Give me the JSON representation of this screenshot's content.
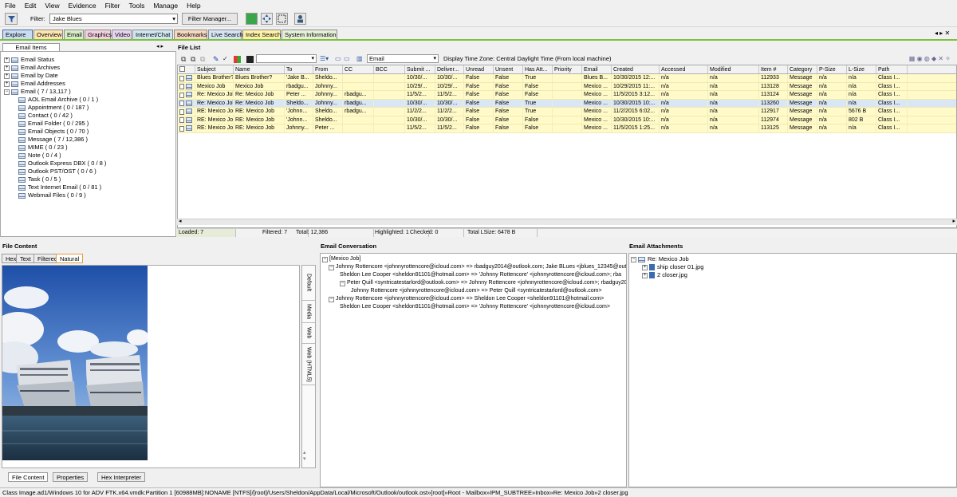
{
  "menu": [
    "File",
    "Edit",
    "View",
    "Evidence",
    "Filter",
    "Tools",
    "Manage",
    "Help"
  ],
  "toolbar": {
    "filter_label": "Filter:",
    "filter_value": "Jake Blues",
    "filter_manager": "Filter Manager..."
  },
  "tabs": [
    "Explore",
    "Overview",
    "Email",
    "Graphics",
    "Video",
    "Internet/Chat",
    "Bookmarks",
    "Live Search",
    "Index Search",
    "System Information"
  ],
  "email_items": {
    "tab": "Email Items",
    "tree": [
      "Email Status",
      "Email Archives",
      "Email by Date",
      "Email Addresses",
      "Email ( 7 / 13,117 )",
      "AOL Email Archive ( 0 / 1 )",
      "Appointment ( 0 / 187 )",
      "Contact ( 0 / 42 )",
      "Email Folder ( 0 / 295 )",
      "Email Objects ( 0 / 70 )",
      "Message ( 7 / 12,386 )",
      "MIME ( 0 / 23 )",
      "Note ( 0 / 4 )",
      "Outlook Express DBX ( 0 / 8 )",
      "Outlook PST/OST ( 0 / 6 )",
      "Task ( 0 / 5 )",
      "Text Internet Email ( 0 / 81 )",
      "Webmail Files ( 0 / 9 )"
    ]
  },
  "file_list": {
    "title": "File List",
    "view_select": "Email",
    "timezone": "Display Time Zone: Central Daylight Time  (From local machine)",
    "columns": [
      "Subject",
      "Name",
      "To",
      "From",
      "CC",
      "BCC",
      "Submit ...",
      "Deliver...",
      "Unread",
      "Unsent",
      "Has Att...",
      "Priority",
      "Email",
      "Created",
      "Accessed",
      "Modified",
      "Item #",
      "Category",
      "P-Size",
      "L-Size",
      "Path"
    ],
    "rows": [
      [
        "Blues Brother?",
        "Blues Brother?",
        "'Jake B...",
        "Sheldo...",
        "",
        "",
        "10/30/...",
        "10/30/...",
        "False",
        "False",
        "True",
        "",
        "Blues B...",
        "10/30/2015 12:...",
        "n/a",
        "n/a",
        "112933",
        "Message",
        "n/a",
        "n/a",
        "Class I..."
      ],
      [
        "Mexico Job",
        "Mexico Job",
        "rbadgu...",
        "Johnny...",
        "",
        "",
        "10/29/...",
        "10/29/...",
        "False",
        "False",
        "False",
        "",
        "Mexico ...",
        "10/29/2015 11:...",
        "n/a",
        "n/a",
        "113128",
        "Message",
        "n/a",
        "n/a",
        "Class I..."
      ],
      [
        "Re: Mexico Job",
        "Re: Mexico Job",
        "Peter ...",
        "Johnny...",
        "rbadgu...",
        "",
        "11/5/2...",
        "11/5/2...",
        "False",
        "False",
        "False",
        "",
        "Mexico ...",
        "11/5/2015 3:12...",
        "n/a",
        "n/a",
        "113124",
        "Message",
        "n/a",
        "n/a",
        "Class I..."
      ],
      [
        "Re: Mexico Job",
        "Re: Mexico Job",
        "Sheldo...",
        "Johnny...",
        "rbadgu...",
        "",
        "10/30/...",
        "10/30/...",
        "False",
        "False",
        "True",
        "",
        "Mexico ...",
        "10/30/2015 10:...",
        "n/a",
        "n/a",
        "113260",
        "Message",
        "n/a",
        "n/a",
        "Class I..."
      ],
      [
        "RE: Mexico Job",
        "RE: Mexico Job",
        "'Johnn...",
        "Sheldo...",
        "rbadgu...",
        "",
        "11/2/2...",
        "11/2/2...",
        "False",
        "False",
        "True",
        "",
        "Mexico ...",
        "11/2/2015 6:02...",
        "n/a",
        "n/a",
        "112917",
        "Message",
        "n/a",
        "5676 B",
        "Class I..."
      ],
      [
        "RE: Mexico Job",
        "RE: Mexico Job",
        "'Johnn...",
        "Sheldo...",
        "",
        "",
        "10/30/...",
        "10/30/...",
        "False",
        "False",
        "False",
        "",
        "Mexico ...",
        "10/30/2015 10:...",
        "n/a",
        "n/a",
        "112974",
        "Message",
        "n/a",
        "802 B",
        "Class I..."
      ],
      [
        "RE: Mexico Job",
        "RE: Mexico Job",
        "Johnny...",
        "Peter ...",
        "",
        "",
        "11/5/2...",
        "11/5/2...",
        "False",
        "False",
        "False",
        "",
        "Mexico ...",
        "11/5/2015 1:25...",
        "n/a",
        "n/a",
        "113125",
        "Message",
        "n/a",
        "n/a",
        "Class I..."
      ]
    ],
    "status": {
      "loaded": "Loaded: 7",
      "filtered": "Filtered: 7",
      "total": "Total: 12,386",
      "highlighted": "Highlighted: 1",
      "checked": "Checked: 0",
      "lsize": "Total LSize: 6478 B"
    }
  },
  "file_content": {
    "title": "File Content",
    "tabs": [
      "Hex",
      "Text",
      "Filtered",
      "Natural"
    ],
    "side_tabs": [
      "Default",
      "Media",
      "Web",
      "Web (HTML5)"
    ],
    "bottom_tabs": [
      "File Content",
      "Properties",
      "Hex Interpreter"
    ]
  },
  "conversation": {
    "title": "Email Conversation",
    "lines": [
      "[Mexico Job]",
      "Johnny Rottencore <johnnyrottencore@icloud.com> => rbadguy2014@outlook.com; Jake BLues <jblues_12345@outl",
      "Sheldon Lee Cooper <sheldon91101@hotmail.com> => 'Johnny Rottencore' <johnnyrottencore@icloud.com>; rba",
      "Peter Quill <syntricatestarlord@outlook.com> => Johnny Rottencore <johnnyrottencore@icloud.com>; rbadguy20",
      "Johnny Rottencore <johnnyrottencore@icloud.com> => Peter Quill <syntricatestarlord@outlook.com>",
      "Johnny Rottencore <johnnyrottencore@icloud.com> => Sheldon Lee Cooper <sheldon91101@hotmail.com>",
      "Sheldon Lee Cooper <sheldon91101@hotmail.com> => 'Johnny Rottencore' <johnnyrottencore@icloud.com>"
    ]
  },
  "attachments": {
    "title": "Email Attachments",
    "items": [
      "Re: Mexico Job",
      "ship closer 01.jpg",
      "2 closer.jpg"
    ]
  },
  "statusbar": "Class Image.ad1/Windows 10 for ADV FTK.x64.vmdk:Partition 1 [60988MB]:NONAME [NTFS]/[root]/Users/Sheldon/AppData/Local/Microsoft/Outlook/outlook.ost»[root]»Root - Mailbox»IPM_SUBTREE»Inbox»Re: Mexico Job»2 closer.jpg",
  "colors": {
    "accent": "#1fa0e0",
    "row_highlight": "#fffac8",
    "selected": "#d9e6f5",
    "green_line": "#7fbf3f"
  }
}
